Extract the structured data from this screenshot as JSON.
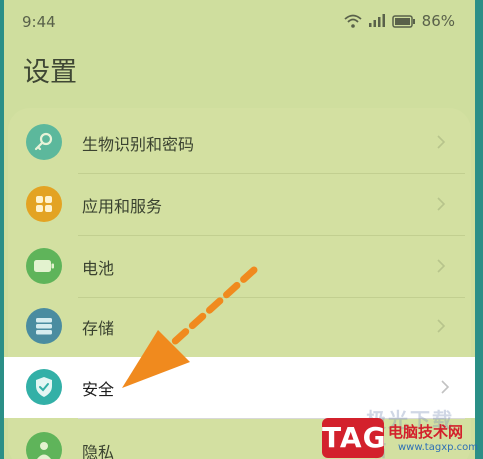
{
  "status": {
    "time": "9:44",
    "battery_percent": "86%"
  },
  "page": {
    "title": "设置"
  },
  "items": [
    {
      "label": "生物识别和密码",
      "icon": "key-icon",
      "color": "#5cb89c"
    },
    {
      "label": "应用和服务",
      "icon": "apps-grid-icon",
      "color": "#e3a323"
    },
    {
      "label": "电池",
      "icon": "battery-icon",
      "color": "#5fb45a"
    },
    {
      "label": "存储",
      "icon": "storage-icon",
      "color": "#4a8ca0"
    },
    {
      "label": "安全",
      "icon": "shield-icon",
      "color": "#33b0a7",
      "selected": true
    },
    {
      "label": "隐私",
      "icon": "privacy-icon",
      "color": "#5fb45a"
    }
  ],
  "watermark": {
    "tag": "TAG",
    "title": "电脑技术网",
    "url": "www.tagxp.com",
    "faint": "极光下载站"
  },
  "colors": {
    "arrow": "#f08a1e",
    "background": "#cfde9e",
    "selected_row": "#ffffff"
  }
}
